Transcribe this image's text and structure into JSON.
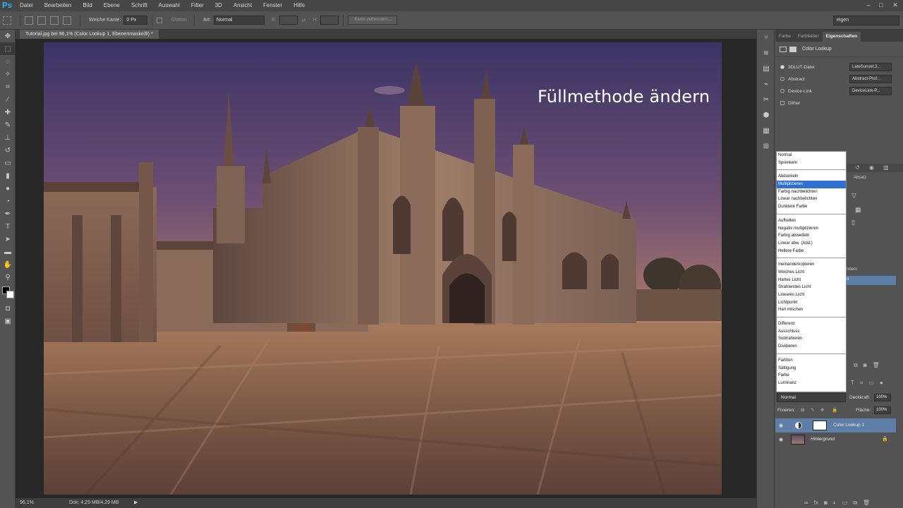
{
  "menubar": {
    "logo": "Ps",
    "items": [
      "Datei",
      "Bearbeiten",
      "Bild",
      "Ebene",
      "Schrift",
      "Auswahl",
      "Filter",
      "3D",
      "Ansicht",
      "Fenster",
      "Hilfe"
    ]
  },
  "options": {
    "feather_label": "Weiche Kante:",
    "feather_value": "0 Px",
    "antialias_label": "Glätten",
    "style_label": "Art:",
    "style_value": "Normal",
    "width_label": "B:",
    "height_label": "H:",
    "refine_button": "Kante verbessern...",
    "workspace": "eigen"
  },
  "document": {
    "tab_title": "Tutorial.jpg bei 96,1% (Color Lookup 1, Ebenenmaske/8) *",
    "overlay_text": "Füllmethode ändern"
  },
  "status": {
    "zoom": "96,1%",
    "doc_size": "Dok: 4,29 MB/4,29 MB"
  },
  "panel": {
    "tabs": [
      "Farbe",
      "Farbfelder",
      "Eigenschaften"
    ],
    "properties_title": "Color Lookup",
    "lut_rows": [
      {
        "label": "3DLUT-Datei",
        "value": "LateSunset.3..."
      },
      {
        "label": "Abstract",
        "value": "Abstract-Prof..."
      },
      {
        "label": "Device-Link",
        "value": "DeviceLink-P..."
      }
    ],
    "dither_label": "Dither",
    "absatz_tab": "Absatz"
  },
  "blend_menu": {
    "groups": [
      [
        "Normal",
        "Sprenkeln"
      ],
      [
        "Abdunkeln",
        "Multiplizieren",
        "Farbig nachbelichten",
        "Linear nachbelichten",
        "Dunklere Farbe"
      ],
      [
        "Aufhellen",
        "Negativ multiplizieren",
        "Farbig abwedeln",
        "Linear abw. (Add.)",
        "Hellere Farbe"
      ],
      [
        "Ineinanderkopieren",
        "Weiches Licht",
        "Hartes Licht",
        "Strahlendes Licht",
        "Lineares Licht",
        "Lichtpunkt",
        "Hart mischen"
      ],
      [
        "Differenz",
        "Ausschluss",
        "Subtrahieren",
        "Dividieren"
      ],
      [
        "Farbton",
        "Sättigung",
        "Farbe",
        "Luminanz"
      ]
    ],
    "selected": "Multiplizieren"
  },
  "layers": {
    "blend_value": "Normal",
    "opacity_label": "Deckkraft:",
    "opacity_value": "100%",
    "lock_label": "Fixieren:",
    "fill_label": "Fläche:",
    "fill_value": "100%",
    "partial_fragment_1": "ndern",
    "partial_fragment_2": "n",
    "items": [
      {
        "name": "Color Lookup 1"
      },
      {
        "name": "Hintergrund"
      }
    ]
  }
}
